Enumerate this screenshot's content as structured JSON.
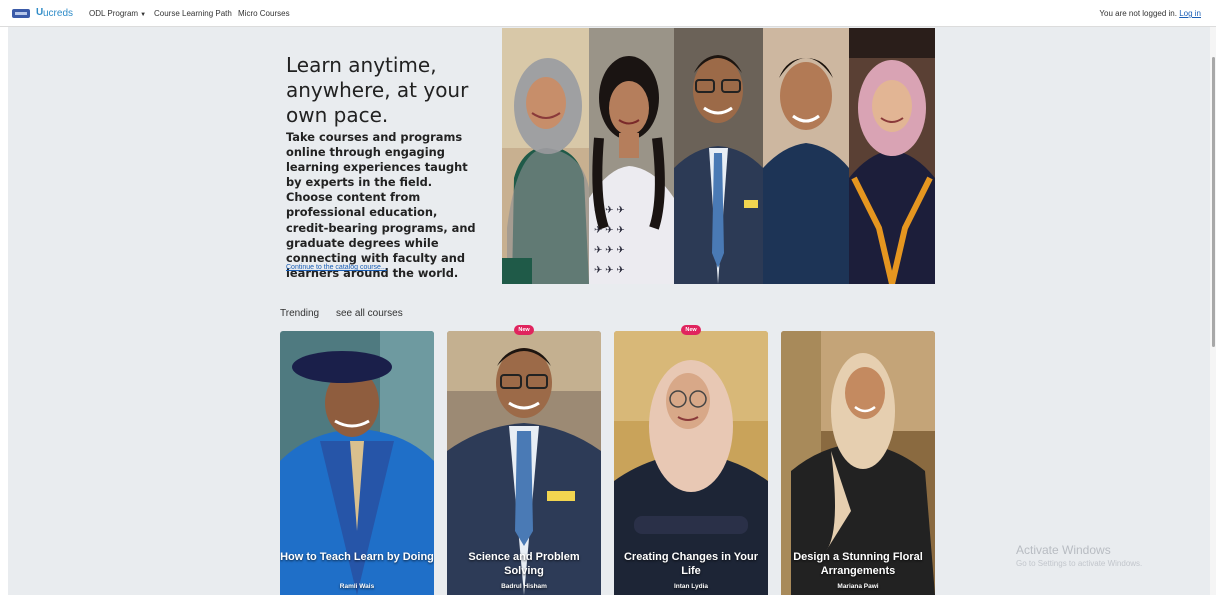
{
  "navbar": {
    "brand": "ucreds",
    "brand_mark": "U",
    "items": [
      {
        "label": "ODL Program",
        "has_dropdown": true
      },
      {
        "label": "Course Learning Path"
      },
      {
        "label": "Micro Courses"
      }
    ],
    "login_status": "You are not logged in.",
    "login_link": "Log in"
  },
  "hero": {
    "title": "Learn anytime, anywhere, at your own pace.",
    "description": "Take courses and programs online through engaging learning experiences taught by experts in the field. Choose content from professional education, credit-bearing programs, and graduate degrees while connecting with faculty and learners around the world.",
    "link": "Continue to the catalog course..."
  },
  "trending": {
    "label": "Trending",
    "see_all": "see all courses"
  },
  "courses": [
    {
      "title": "How to Teach Learn by Doing",
      "author": "Ramli Wais",
      "new": false
    },
    {
      "title": "Science and Problem Solving",
      "author": "Badrul Hisham",
      "new": true
    },
    {
      "title": "Creating Changes in Your Life",
      "author": "Intan Lydia",
      "new": true
    },
    {
      "title": "Design a Stunning Floral Arrangements",
      "author": "Mariana Pawi",
      "new": false
    }
  ],
  "badge_label": "New",
  "watermark": {
    "title": "Activate Windows",
    "subtitle": "Go to Settings to activate Windows."
  },
  "colors": {
    "background": "#e9ecef",
    "link": "#1b5fb6",
    "brand": "#2f8cc8",
    "badge": "#e0245e"
  }
}
